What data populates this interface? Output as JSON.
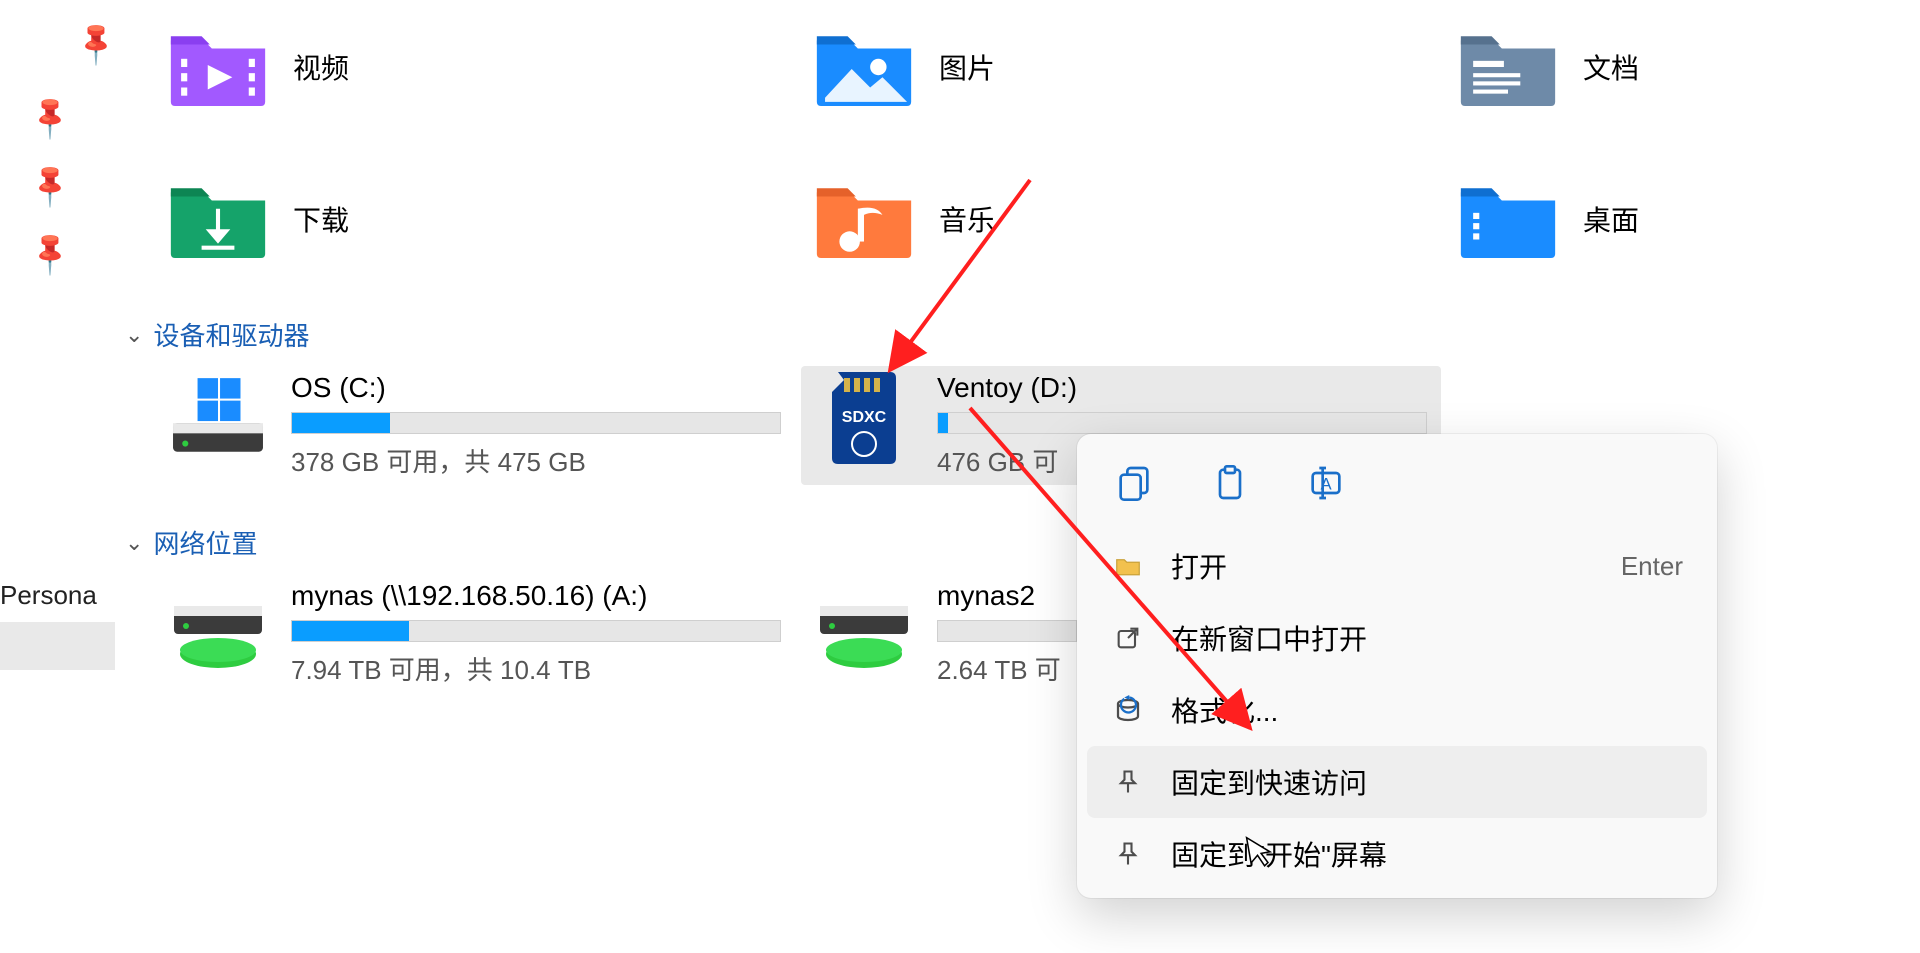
{
  "sidebar": {
    "persona_label": "Persona"
  },
  "folders": {
    "videos": "视频",
    "pictures": "图片",
    "documents": "文档",
    "downloads": "下载",
    "music": "音乐",
    "desktop": "桌面"
  },
  "sections": {
    "devices": "设备和驱动器",
    "network": "网络位置"
  },
  "drives": {
    "os": {
      "name": "OS (C:)",
      "sub": "378 GB 可用，共 475 GB",
      "fill_pct": 20
    },
    "ventoy": {
      "name": "Ventoy (D:)",
      "sub": "476 GB 可",
      "fill_pct": 2
    },
    "mynas": {
      "name": "mynas (\\\\192.168.50.16) (A:)",
      "sub": "7.94 TB 可用，共 10.4 TB",
      "fill_pct": 24
    },
    "mynas2": {
      "name": "mynas2",
      "sub": "2.64 TB 可",
      "fill_pct": 0
    }
  },
  "context_menu": {
    "open": "打开",
    "open_shortcut": "Enter",
    "open_new_window": "在新窗口中打开",
    "format": "格式化...",
    "pin_quick_access": "固定到快速访问",
    "pin_start": "固定到\"开始\"屏幕"
  }
}
